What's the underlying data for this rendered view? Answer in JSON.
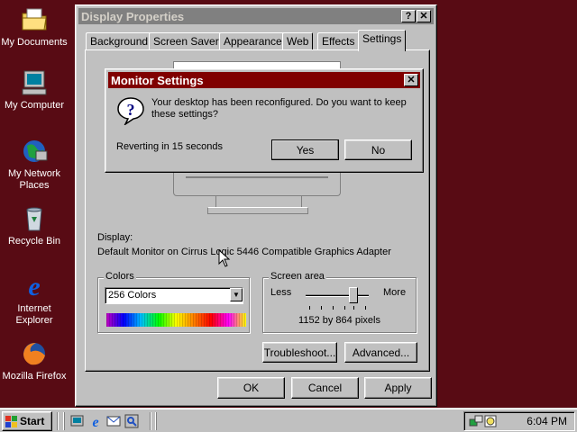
{
  "desktop": {
    "icons": [
      {
        "label": "My Documents",
        "icon": "my-documents-icon"
      },
      {
        "label": "My Computer",
        "icon": "my-computer-icon"
      },
      {
        "label": "My Network Places",
        "icon": "network-places-icon"
      },
      {
        "label": "Recycle Bin",
        "icon": "recycle-bin-icon"
      },
      {
        "label": "Internet Explorer",
        "icon": "internet-explorer-icon"
      },
      {
        "label": "Mozilla Firefox",
        "icon": "firefox-icon"
      }
    ],
    "background_color": "#580b14"
  },
  "display_properties": {
    "title": "Display Properties",
    "help_button": "?",
    "close_button": "✕",
    "tabs": [
      "Background",
      "Screen Saver",
      "Appearance",
      "Web",
      "Effects",
      "Settings"
    ],
    "active_tab": "Settings",
    "display_label": "Display:",
    "display_value": "Default Monitor on Cirrus Logic 5446 Compatible Graphics Adapter",
    "colors": {
      "legend": "Colors",
      "selected": "256 Colors"
    },
    "screen_area": {
      "legend": "Screen area",
      "less": "Less",
      "more": "More",
      "value": "1152 by 864 pixels",
      "slider_level": 0.8
    },
    "troubleshoot_button": "Troubleshoot...",
    "advanced_button": "Advanced...",
    "ok_button": "OK",
    "cancel_button": "Cancel",
    "apply_button": "Apply"
  },
  "monitor_settings": {
    "title": "Monitor Settings",
    "close_button": "✕",
    "message": "Your desktop has been reconfigured.  Do you want to keep these settings?",
    "countdown": "Reverting in 15 seconds",
    "yes_button": "Yes",
    "no_button": "No",
    "title_color": "#800000"
  },
  "taskbar": {
    "start_label": "Start",
    "time": "6:04 PM",
    "quick_launch": [
      "show-desktop-icon",
      "internet-explorer-icon",
      "outlook-icon",
      "channels-icon"
    ]
  }
}
